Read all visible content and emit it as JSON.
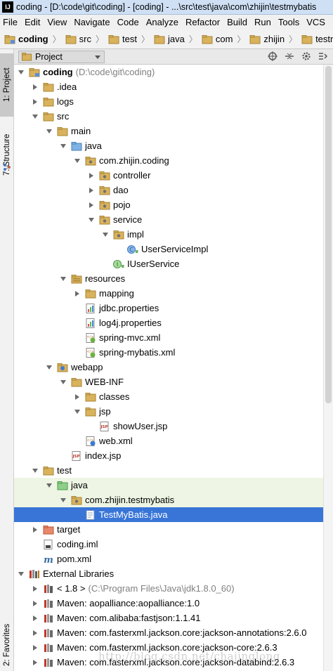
{
  "window": {
    "title": "coding - [D:\\code\\git\\coding] - [coding] - ...\\src\\test\\java\\com\\zhijin\\testmybatis",
    "logo": "IJ"
  },
  "menu": [
    "File",
    "Edit",
    "View",
    "Navigate",
    "Code",
    "Analyze",
    "Refactor",
    "Build",
    "Run",
    "Tools",
    "VCS"
  ],
  "breadcrumbs": [
    "coding",
    "src",
    "test",
    "java",
    "com",
    "zhijin",
    "testmybatis"
  ],
  "sidebar": {
    "project_tab": "1: Project",
    "structure_tab": "7: Structure",
    "favorites_tab": "2: Favorites"
  },
  "panel": {
    "view": "Project"
  },
  "tree": [
    {
      "label": "coding",
      "detail": "(D:\\code\\git\\coding)",
      "icon": "module-icon",
      "arrow": "down",
      "level": 0,
      "bold": true
    },
    {
      "label": ".idea",
      "icon": "folder-icon",
      "arrow": "right",
      "level": 1
    },
    {
      "label": "logs",
      "icon": "folder-icon",
      "arrow": "right",
      "level": 1
    },
    {
      "label": "src",
      "icon": "folder-icon",
      "arrow": "down",
      "level": 1
    },
    {
      "label": "main",
      "icon": "folder-icon",
      "arrow": "down",
      "level": 2
    },
    {
      "label": "java",
      "icon": "source-folder-icon",
      "arrow": "down",
      "level": 3
    },
    {
      "label": "com.zhijin.coding",
      "icon": "package-icon",
      "arrow": "down",
      "level": 4
    },
    {
      "label": "controller",
      "icon": "package-icon",
      "arrow": "right",
      "level": 5
    },
    {
      "label": "dao",
      "icon": "package-icon",
      "arrow": "right",
      "level": 5
    },
    {
      "label": "pojo",
      "icon": "package-icon",
      "arrow": "right",
      "level": 5
    },
    {
      "label": "service",
      "icon": "package-icon",
      "arrow": "down",
      "level": 5
    },
    {
      "label": "impl",
      "icon": "package-icon",
      "arrow": "down",
      "level": 6
    },
    {
      "label": "UserServiceImpl",
      "icon": "class-icon",
      "arrow": "none",
      "level": 7
    },
    {
      "label": "IUserService",
      "icon": "interface-icon",
      "arrow": "none",
      "level": 6
    },
    {
      "label": "resources",
      "icon": "resources-folder-icon",
      "arrow": "down",
      "level": 3
    },
    {
      "label": "mapping",
      "icon": "folder-icon",
      "arrow": "right",
      "level": 4
    },
    {
      "label": "jdbc.properties",
      "icon": "properties-file-icon",
      "arrow": "none",
      "level": 4
    },
    {
      "label": "log4j.properties",
      "icon": "properties-file-icon",
      "arrow": "none",
      "level": 4
    },
    {
      "label": "spring-mvc.xml",
      "icon": "spring-xml-icon",
      "arrow": "none",
      "level": 4
    },
    {
      "label": "spring-mybatis.xml",
      "icon": "spring-xml-icon",
      "arrow": "none",
      "level": 4
    },
    {
      "label": "webapp",
      "icon": "web-folder-icon",
      "arrow": "down",
      "level": 2
    },
    {
      "label": "WEB-INF",
      "icon": "folder-icon",
      "arrow": "down",
      "level": 3
    },
    {
      "label": "classes",
      "icon": "folder-icon",
      "arrow": "right",
      "level": 4
    },
    {
      "label": "jsp",
      "icon": "folder-icon",
      "arrow": "down",
      "level": 4
    },
    {
      "label": "showUser.jsp",
      "icon": "jsp-file-icon",
      "arrow": "none",
      "level": 5
    },
    {
      "label": "web.xml",
      "icon": "web-xml-icon",
      "arrow": "none",
      "level": 4
    },
    {
      "label": "index.jsp",
      "icon": "jsp-file-icon",
      "arrow": "none",
      "level": 3
    },
    {
      "label": "test",
      "icon": "folder-icon",
      "arrow": "down",
      "level": 1
    },
    {
      "label": "java",
      "icon": "test-source-folder-icon",
      "arrow": "down",
      "level": 2,
      "green": true
    },
    {
      "label": "com.zhijin.testmybatis",
      "icon": "package-icon",
      "arrow": "down",
      "level": 3,
      "green": true
    },
    {
      "label": "TestMyBatis.java",
      "icon": "java-file-icon",
      "arrow": "none",
      "level": 4,
      "selected": true
    },
    {
      "label": "target",
      "icon": "excluded-folder-icon",
      "arrow": "right",
      "level": 1
    },
    {
      "label": "coding.iml",
      "icon": "iml-file-icon",
      "arrow": "none",
      "level": 1
    },
    {
      "label": "pom.xml",
      "icon": "maven-icon",
      "arrow": "none",
      "level": 1
    },
    {
      "label": "External Libraries",
      "icon": "libraries-icon",
      "arrow": "down",
      "level": 0
    },
    {
      "label": "< 1.8 >",
      "detail": "(C:\\Program Files\\Java\\jdk1.8.0_60)",
      "icon": "jdk-icon",
      "arrow": "right",
      "level": 1
    },
    {
      "label": "Maven: aopalliance:aopalliance:1.0",
      "icon": "library-icon",
      "arrow": "right",
      "level": 1
    },
    {
      "label": "Maven: com.alibaba:fastjson:1.1.41",
      "icon": "library-icon",
      "arrow": "right",
      "level": 1
    },
    {
      "label": "Maven: com.fasterxml.jackson.core:jackson-annotations:2.6.0",
      "icon": "library-icon",
      "arrow": "right",
      "level": 1
    },
    {
      "label": "Maven: com.fasterxml.jackson.core:jackson-core:2.6.3",
      "icon": "library-icon",
      "arrow": "right",
      "level": 1
    },
    {
      "label": "Maven: com.fasterxml.jackson.core:jackson-databind:2.6.3",
      "icon": "library-icon",
      "arrow": "right",
      "level": 1
    }
  ],
  "watermark": "http://blog.csdn.net/chajinglong",
  "colors": {
    "selection": "#3875d7",
    "test_source_bg": "#eef5e4",
    "folder": "#d9b25c",
    "package": "#8a8a8a"
  }
}
